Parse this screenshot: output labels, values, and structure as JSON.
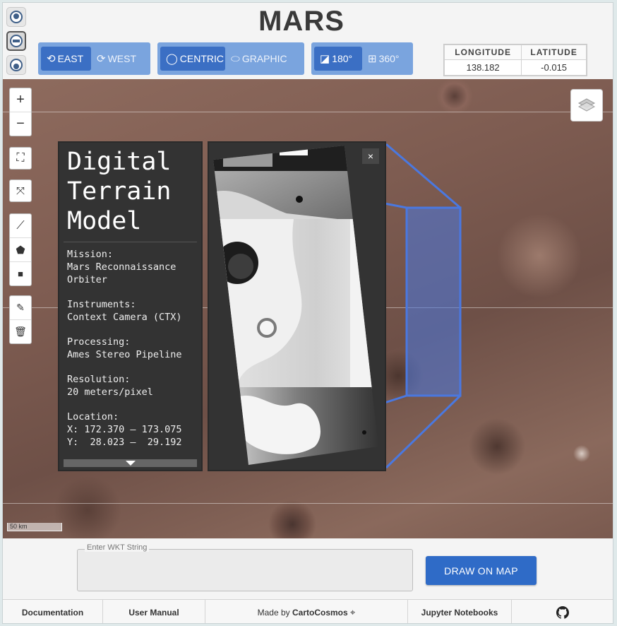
{
  "app": {
    "title": "MARS"
  },
  "planets": [
    {
      "name": "globe-icon",
      "active": false
    },
    {
      "name": "globe-icon",
      "active": true
    },
    {
      "name": "globe-icon",
      "active": false
    }
  ],
  "direction": {
    "east": "EAST",
    "west": "WEST",
    "selected": "EAST"
  },
  "latitude_type": {
    "centric": "CENTRIC",
    "graphic": "GRAPHIC",
    "selected": "CENTRIC"
  },
  "longitude_range": {
    "r180": "180°",
    "r360": "360°",
    "selected": "180°"
  },
  "coords": {
    "lon_label": "LONGITUDE",
    "lat_label": "LATITUDE",
    "lon_value": "138.182",
    "lat_value": "-0.015"
  },
  "map": {
    "zoom_in": "+",
    "zoom_out": "−",
    "scale_label": "50 km",
    "highlight_color": "#4a78e0"
  },
  "info": {
    "title": "Digital\nTerrain\nModel",
    "mission_label": "Mission:",
    "mission_value": "Mars Reconnaissance\nOrbiter",
    "instruments_label": "Instruments:",
    "instruments_value": "Context Camera (CTX)",
    "processing_label": "Processing:",
    "processing_value": "Ames Stereo Pipeline",
    "resolution_label": "Resolution:",
    "resolution_value": "20 meters/pixel",
    "location_label": "Location:",
    "location_x": "X: 172.370 – 173.075",
    "location_y": "Y:  28.023 –  29.192"
  },
  "image_panel": {
    "close": "×"
  },
  "wkt": {
    "label": "Enter WKT String",
    "value": ""
  },
  "draw_button": "DRAW ON MAP",
  "footer": {
    "documentation": "Documentation",
    "manual": "User Manual",
    "made_by": "Made by",
    "brand": "CartoCosmos",
    "jupyter": "Jupyter Notebooks"
  }
}
